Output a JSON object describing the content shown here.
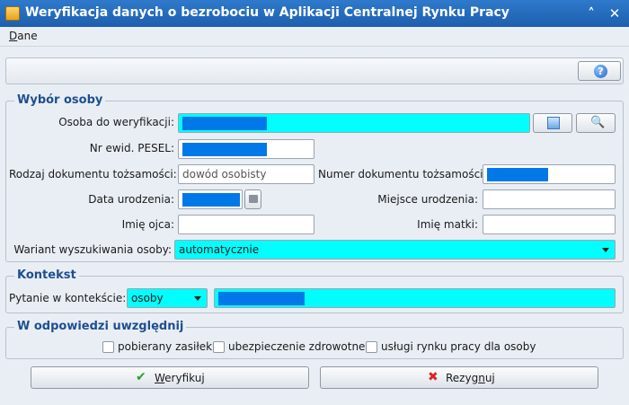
{
  "window": {
    "title": "Weryfikacja danych o bezrobociu w Aplikacji Centralnej Rynku Pracy"
  },
  "menu": {
    "items": [
      {
        "label": "Dane"
      }
    ]
  },
  "person_group": {
    "title": "Wybór osoby",
    "person_label": "Osoba do weryfikacji:",
    "person_value": "",
    "pesel_label": "Nr ewid. PESEL:",
    "pesel_value": "",
    "doc_type_label": "Rodzaj dokumentu tożsamości:",
    "doc_type_placeholder": "dowód osobisty",
    "doc_number_label": "Numer dokumentu tożsamości:",
    "doc_number_value": "",
    "birth_date_label": "Data urodzenia:",
    "birth_date_value": "",
    "birth_place_label": "Miejsce urodzenia:",
    "birth_place_value": "",
    "father_name_label": "Imię ojca:",
    "father_name_value": "",
    "mother_name_label": "Imię matki:",
    "mother_name_value": "",
    "search_variant_label": "Wariant wyszukiwania osoby:",
    "search_variant_value": "automatycznie"
  },
  "context_group": {
    "title": "Kontekst",
    "question_label": "Pytanie w kontekście:",
    "question_value": "osoby",
    "context_value": ""
  },
  "include_group": {
    "title": "W odpowiedzi uwzględnij",
    "options": [
      {
        "label": "pobierany zasiłek",
        "checked": false
      },
      {
        "label": "ubezpieczenie zdrowotne",
        "checked": false
      },
      {
        "label": "usługi rynku pracy dla osoby",
        "checked": false
      }
    ]
  },
  "actions": {
    "verify_label_u": "W",
    "verify_label_rest": "eryfikuj",
    "cancel_label_pre": "Rezyg",
    "cancel_label_u": "n",
    "cancel_label_rest": "uj"
  },
  "colors": {
    "accent": "#00ffff",
    "selection": "#0078e8",
    "title_bar": "#2f79cc",
    "group_title": "#1d4f91"
  }
}
